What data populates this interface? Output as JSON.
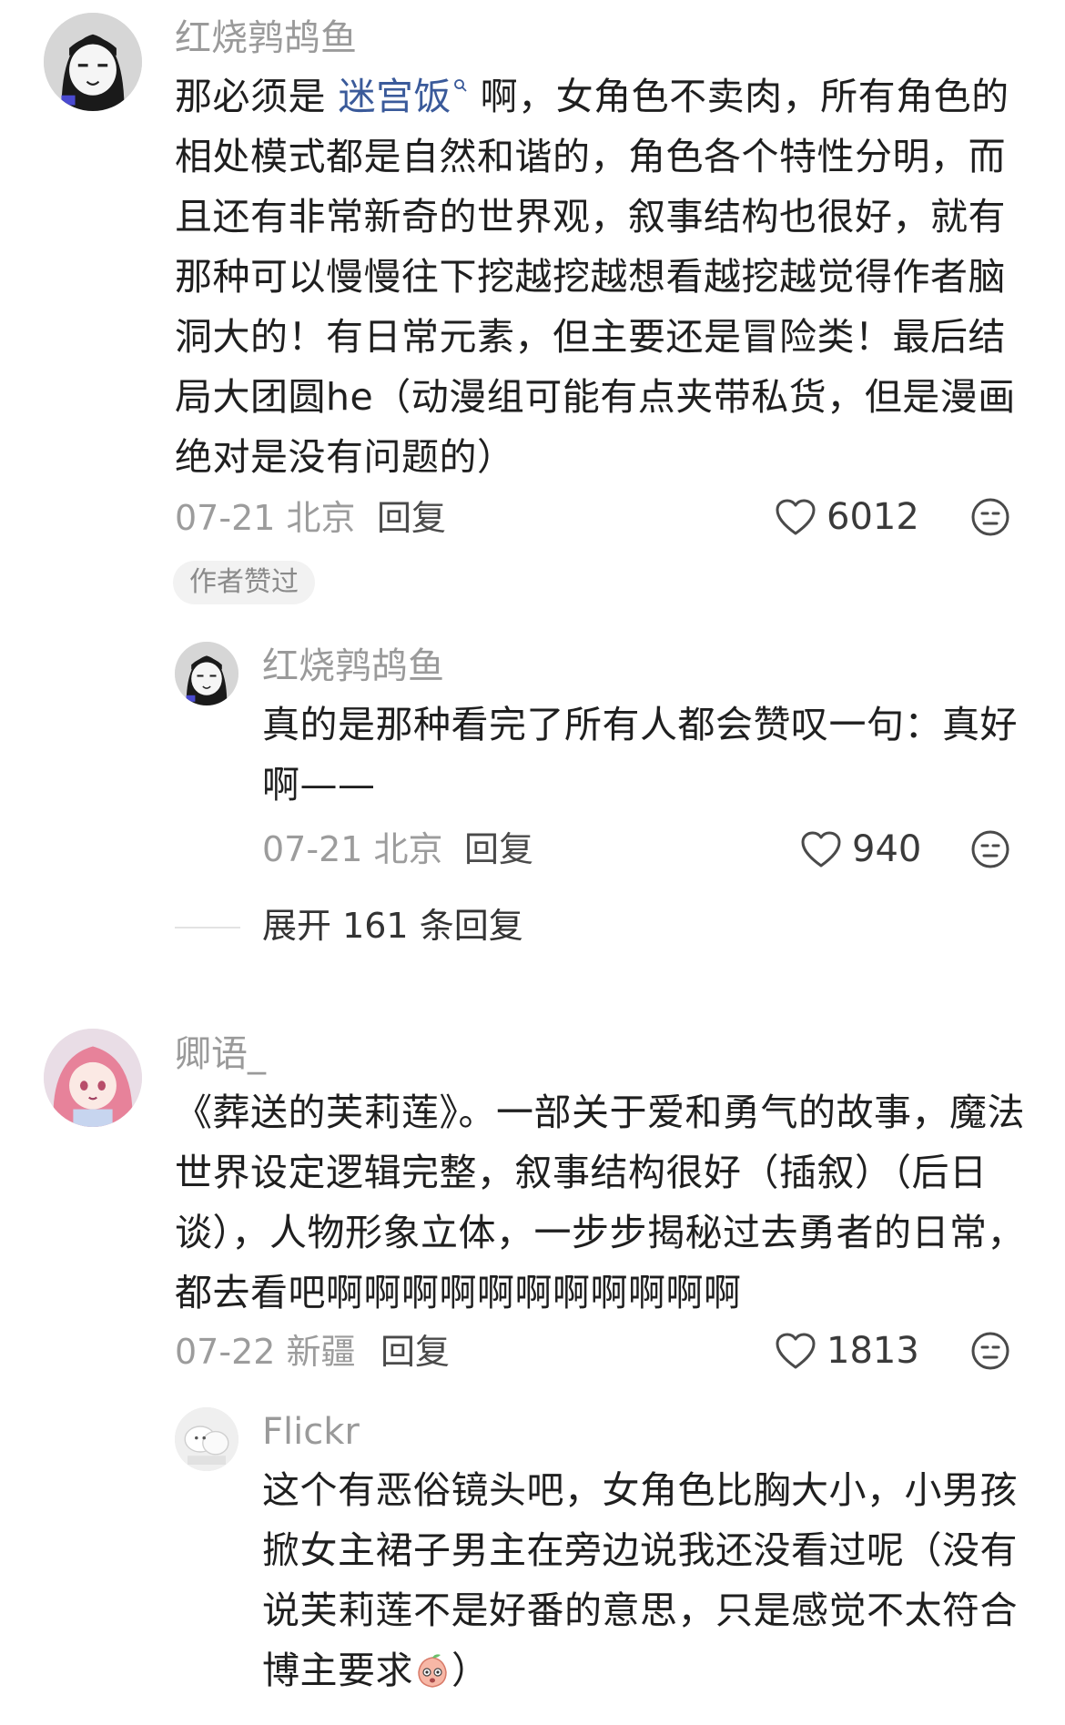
{
  "comments": [
    {
      "username": "红烧鹑鸪鱼",
      "text_before_link": "那必须是 ",
      "link_text": "迷宫饭",
      "text_after_link": " 啊，女角色不卖肉，所有角色的相处模式都是自然和谐的，角色各个特性分明，而且还有非常新奇的世界观，叙事结构也很好，就有那种可以慢慢往下挖越挖越想看越挖越觉得作者脑洞大的！有日常元素，但主要还是冒险类！最后结局大团圆he（动漫组可能有点夹带私货，但是漫画绝对是没有问题的）",
      "date_location": "07-21 北京",
      "reply_label": "回复",
      "likes": "6012",
      "author_badge": "作者赞过",
      "replies": [
        {
          "username": "红烧鹑鸪鱼",
          "text": "真的是那种看完了所有人都会赞叹一句：真好啊——",
          "date_location": "07-21 北京",
          "reply_label": "回复",
          "likes": "940"
        }
      ],
      "expand_label": "展开 161 条回复"
    },
    {
      "username": "卿语_",
      "text": "《葬送的芙莉莲》。一部关于爱和勇气的故事，魔法世界设定逻辑完整，叙事结构很好（插叙）（后日谈），人物形象立体，一步步揭秘过去勇者的日常，都去看吧啊啊啊啊啊啊啊啊啊啊啊",
      "date_location": "07-22 新疆",
      "reply_label": "回复",
      "likes": "1813",
      "replies": [
        {
          "username": "Flickr",
          "text_main": "这个有恶俗镜头吧，女角色比胸大小，小男孩掀女主裙子男主在旁边说我还没看过呢（没有说芙莉莲不是好番的意思，只是感觉不太符合博主要求",
          "text_end": "）"
        }
      ]
    }
  ],
  "icons": {
    "like": "heart-outline-icon",
    "dislike": "neutral-face-icon",
    "search_mark": "search-icon",
    "sticker": "peach-face-sticker"
  },
  "colors": {
    "link": "#3a5a9a",
    "username": "#9a9a9a",
    "meta": "#9c9c9c"
  }
}
